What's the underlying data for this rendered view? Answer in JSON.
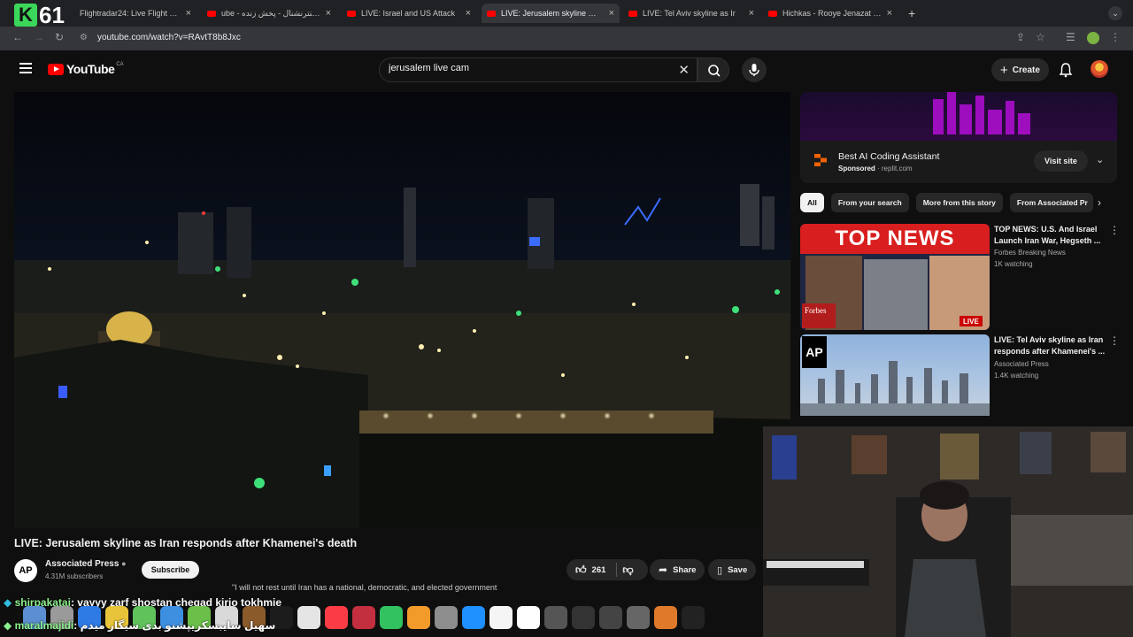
{
  "browser": {
    "tabs": [
      {
        "title": "Flightradar24: Live Flight Trac",
        "active": false
      },
      {
        "title": "ube - ایران اینترنشنال - پخش زنده",
        "active": false
      },
      {
        "title": "LIVE: Israel and US Attack",
        "active": false
      },
      {
        "title": "LIVE: Jerusalem skyline as Ira",
        "active": true
      },
      {
        "title": "LIVE: Tel Aviv skyline as Ir",
        "active": false
      },
      {
        "title": "Hichkas - Rooye Jenazat Mi",
        "active": false
      }
    ],
    "overlay_badge": {
      "letter": "K",
      "number": "61"
    },
    "url": "youtube.com/watch?v=RAvtT8b8Jxc",
    "new_tab_label": "+"
  },
  "youtube": {
    "logo_text": "YouTube",
    "country_code": "CA",
    "search_value": "jerusalem live cam",
    "create_label": "Create"
  },
  "video": {
    "title": "LIVE: Jerusalem skyline as Iran responds after Khamenei's death",
    "channel": "Associated Press",
    "channel_logo": "AP",
    "subscribers": "4.31M subscribers",
    "subscribe_label": "Subscribe",
    "likes": "261",
    "share_label": "Share",
    "save_label": "Save",
    "quote": "\"I will not rest until Iran has a national, democratic, and elected government"
  },
  "ad": {
    "title": "Best AI Coding Assistant",
    "sponsored_label": "Sponsored",
    "domain": "replit.com",
    "visit_label": "Visit site"
  },
  "chips": [
    "All",
    "From your search",
    "More from this story",
    "From Associated Pr"
  ],
  "recommendations": [
    {
      "title": "TOP NEWS: U.S. And Israel Launch Iran War, Hegseth ...",
      "channel": "Forbes Breaking News",
      "views": "1K watching",
      "thumb_text": "TOP NEWS",
      "thumb_badge": "Forbes",
      "live_label": "LIVE"
    },
    {
      "title": "LIVE: Tel Aviv skyline as Iran responds after Khamenei's ...",
      "channel": "Associated Press",
      "views": "1.4K watching",
      "thumb_badge": "AP"
    }
  ],
  "chat": [
    {
      "user": "shirpakatai",
      "message": ": vayyy zarf shostan cheqad kirio tokhmie"
    },
    {
      "user": "maralmajidi",
      "message": ": سهیل سایبسکریپشنو بدی سیگار میدم"
    }
  ],
  "colors": {
    "yt_red": "#ff0000",
    "background": "#0f0f0f",
    "chip_bg": "#272727",
    "chat_user": "#8cf08c"
  }
}
